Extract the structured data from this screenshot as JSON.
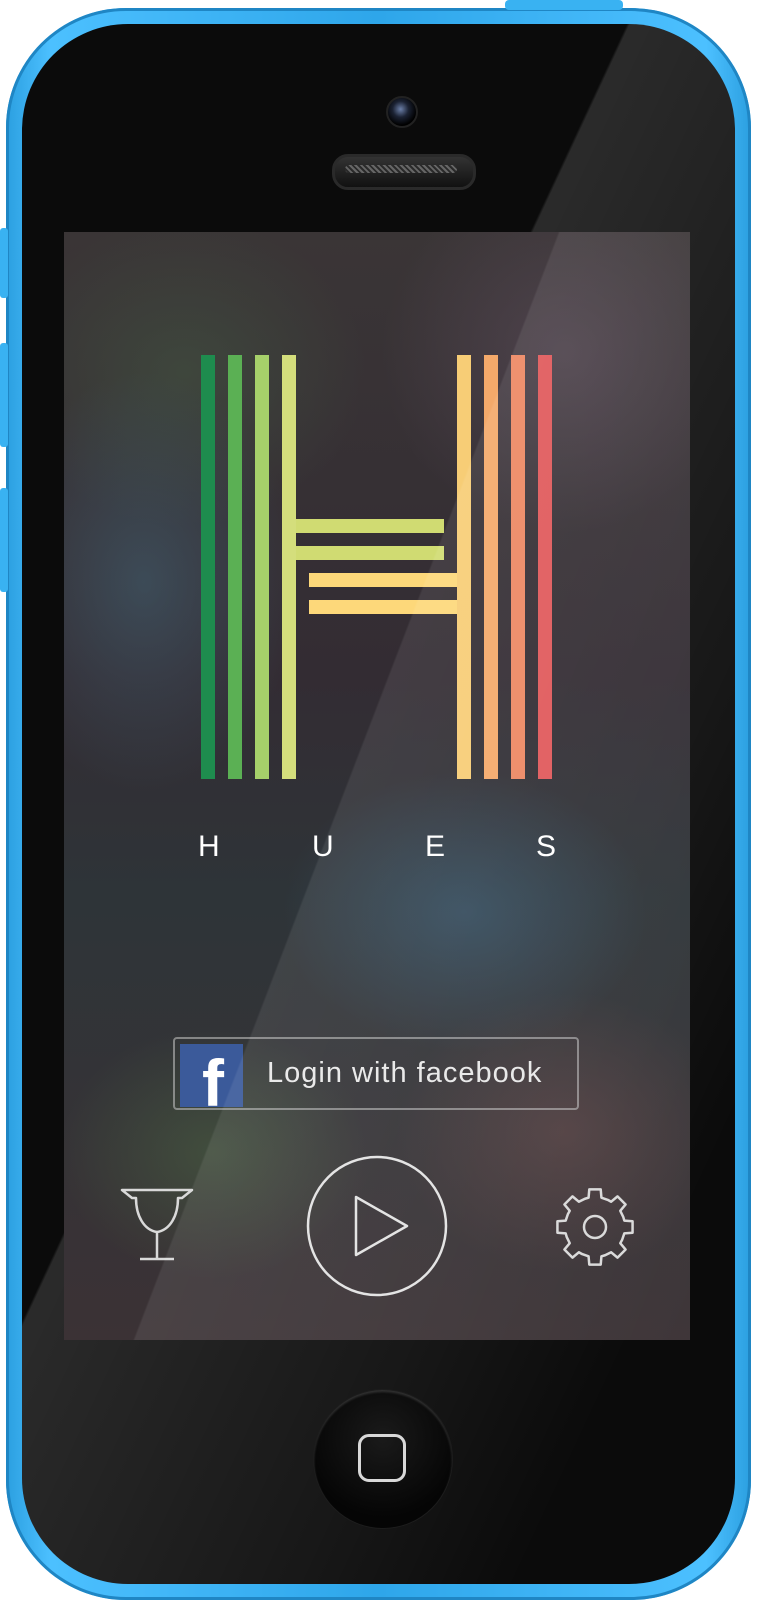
{
  "app": {
    "name_letters": [
      "H",
      "U",
      "E",
      "S"
    ]
  },
  "logo": {
    "left_bar_colors": [
      "#1e8c4e",
      "#5bb054",
      "#a6d06a",
      "#d4de7c"
    ],
    "right_bar_colors": [
      "#f7cd76",
      "#f4a96a",
      "#ed8863",
      "#e0595b"
    ],
    "upper_crossbar_color": "#d0db72",
    "lower_crossbar_color": "#fdd87a"
  },
  "login": {
    "label": "Login with facebook",
    "icon": "facebook-icon",
    "icon_letter": "f",
    "brand_color": "#3b5a9a"
  },
  "toolbar": {
    "items": [
      {
        "icon": "trophy-icon"
      },
      {
        "icon": "play-icon"
      },
      {
        "icon": "gear-icon"
      }
    ]
  },
  "device": {
    "shell_color": "#3cb4f4"
  }
}
